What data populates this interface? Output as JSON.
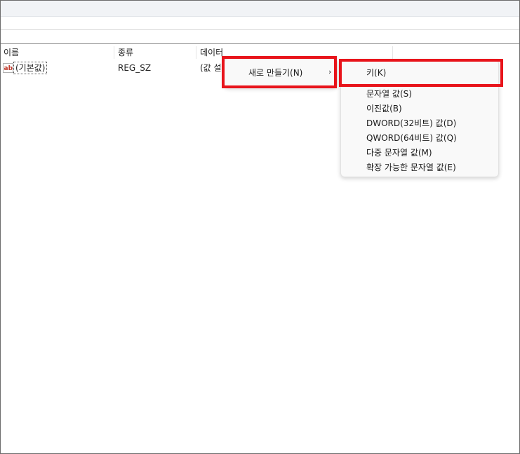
{
  "columns": {
    "name": "이름",
    "type": "종류",
    "data": "데이터"
  },
  "row": {
    "icon": "ab-string-icon",
    "icon_text": "ab",
    "name": "(기본값)",
    "type": "REG_SZ",
    "data": "(값 설"
  },
  "context_menu": {
    "new_label": "새로 만들기(N)",
    "arrow": "›"
  },
  "submenu": {
    "items": [
      "키(K)",
      "문자열 값(S)",
      "이진값(B)",
      "DWORD(32비트) 값(D)",
      "QWORD(64비트) 값(Q)",
      "다중 문자열 값(M)",
      "확장 가능한 문자열 값(E)"
    ]
  },
  "colors": {
    "highlight": "#e8141b",
    "menu_bg": "#f9f9f9",
    "icon_red": "#c0392b"
  }
}
